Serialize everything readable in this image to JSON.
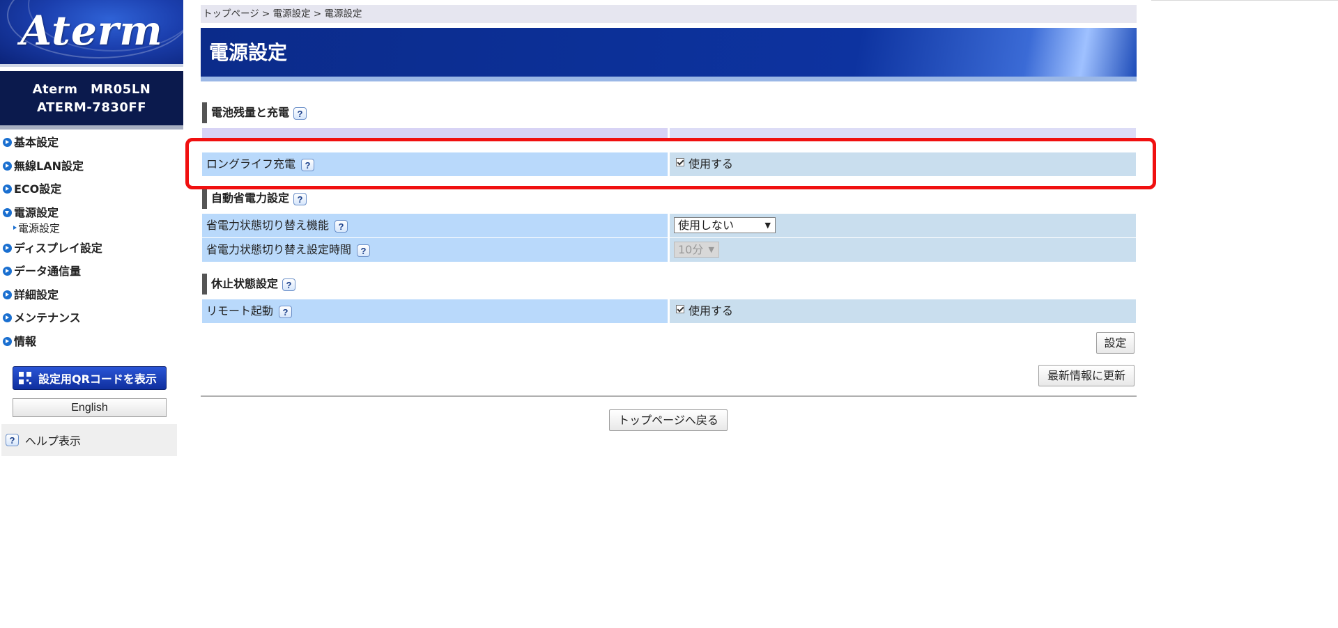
{
  "sidebar": {
    "logo_text": "Aterm",
    "device_line1": "Aterm　MR05LN",
    "device_line2": "ATERM-7830FF",
    "nav": [
      {
        "label": "基本設定"
      },
      {
        "label": "無線LAN設定"
      },
      {
        "label": "ECO設定"
      },
      {
        "label": "電源設定"
      },
      {
        "label": "ディスプレイ設定"
      },
      {
        "label": "データ通信量"
      },
      {
        "label": "詳細設定"
      },
      {
        "label": "メンテナンス"
      },
      {
        "label": "情報"
      }
    ],
    "sub_item": "電源設定",
    "qr_button": "設定用QRコードを表示",
    "english_button": "English",
    "help_label": "ヘルプ表示",
    "help_icon": "?"
  },
  "breadcrumb": "トップページ > 電源設定 > 電源設定",
  "page_title": "電源設定",
  "sections": {
    "battery": {
      "title": "電池残量と充電",
      "long_life_label": "ロングライフ充電",
      "long_life_value": "使用する"
    },
    "auto_power": {
      "title": "自動省電力設定",
      "switch_label": "省電力状態切り替え機能",
      "switch_value": "使用しない",
      "time_label": "省電力状態切り替え設定時間",
      "time_value": "10分"
    },
    "sleep": {
      "title": "休止状態設定",
      "remote_label": "リモート起動",
      "remote_value": "使用する"
    }
  },
  "buttons": {
    "set": "設定",
    "refresh": "最新情報に更新",
    "back_top": "トップページへ戻る"
  },
  "colors": {
    "title_bar": "#0d33a0",
    "label_cell": "#b9d9fb",
    "value_cell": "#c9deee",
    "highlight": "#f01010"
  }
}
